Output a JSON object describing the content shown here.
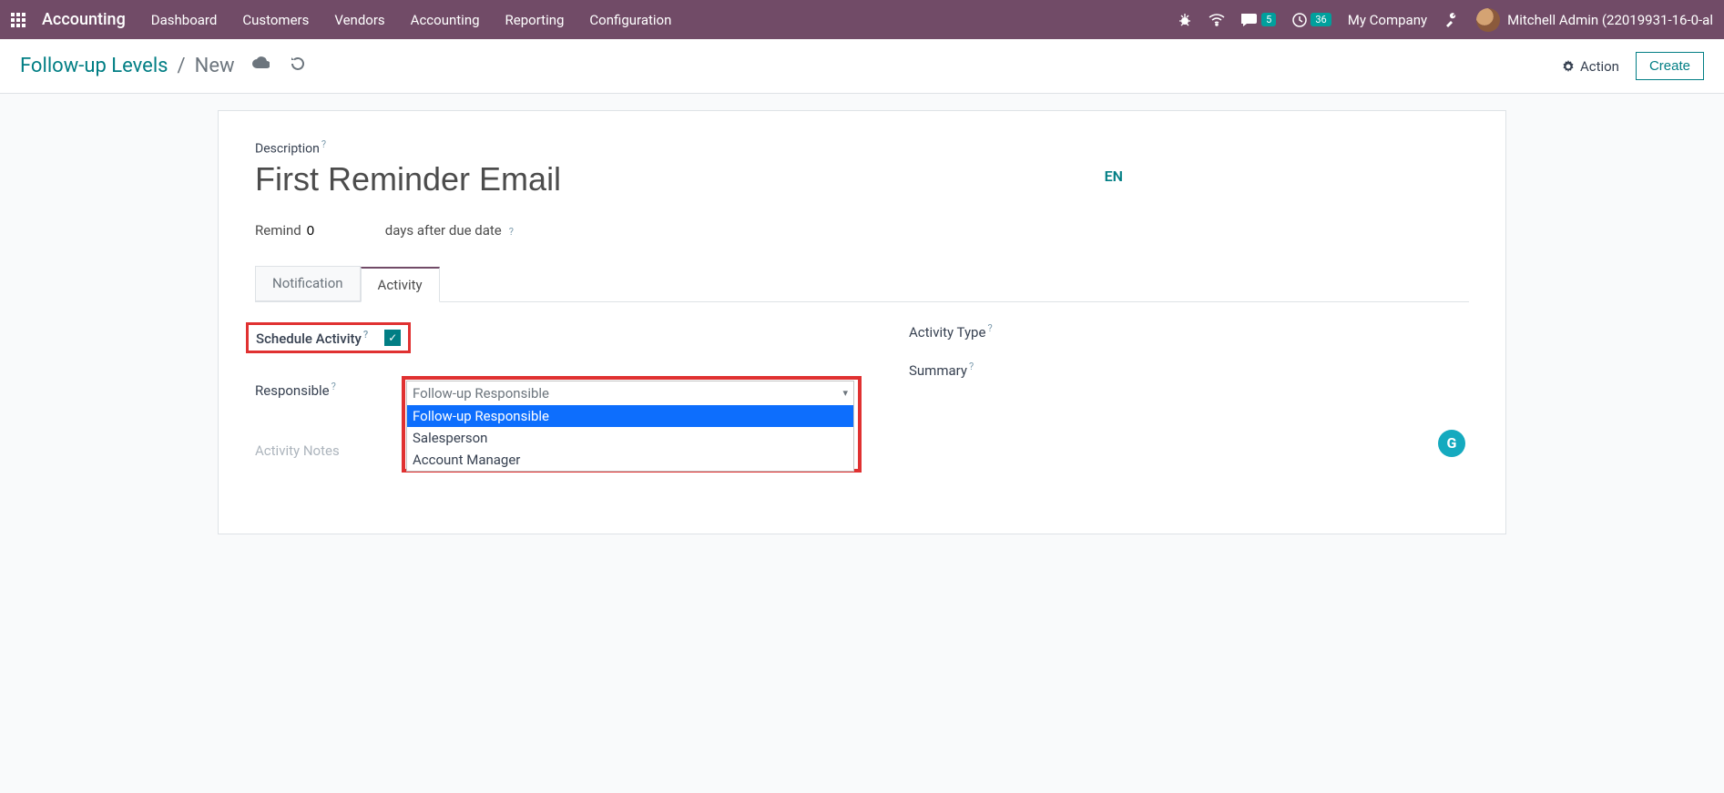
{
  "topbar": {
    "brand": "Accounting",
    "menu": [
      "Dashboard",
      "Customers",
      "Vendors",
      "Accounting",
      "Reporting",
      "Configuration"
    ],
    "messages_badge": "5",
    "clock_badge": "36",
    "company": "My Company",
    "user": "Mitchell Admin (22019931-16-0-al"
  },
  "control": {
    "bc_root": "Follow-up Levels",
    "bc_sep": "/",
    "bc_current": "New",
    "action_label": "Action",
    "create_label": "Create"
  },
  "form": {
    "description_label": "Description",
    "title": "First Reminder Email",
    "lang": "EN",
    "remind_prefix": "Remind",
    "remind_value": "0",
    "remind_suffix": "days after due date",
    "tabs": {
      "notification": "Notification",
      "activity": "Activity"
    },
    "schedule_label": "Schedule Activity",
    "schedule_checked": true,
    "responsible_label": "Responsible",
    "responsible_value": "Follow-up Responsible",
    "responsible_options": [
      "Follow-up Responsible",
      "Salesperson",
      "Account Manager"
    ],
    "activity_notes_label": "Activity Notes",
    "activity_type_label": "Activity Type",
    "summary_label": "Summary",
    "float_badge": "G",
    "hint": "?"
  }
}
